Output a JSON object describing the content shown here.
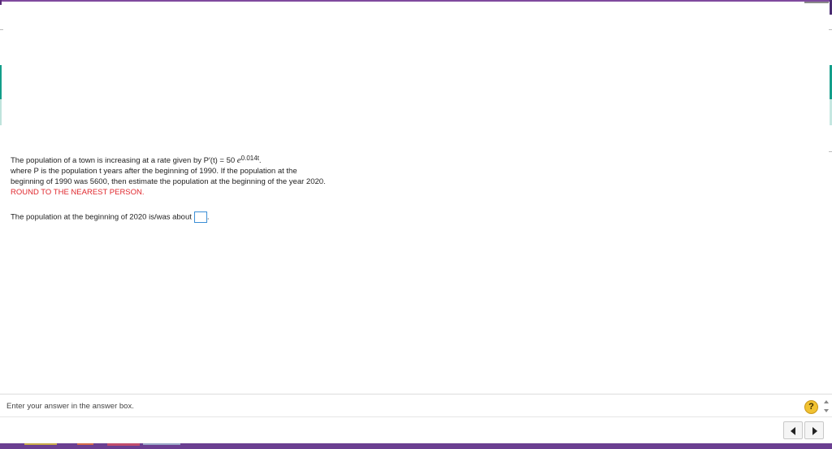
{
  "question": {
    "intro": "The population of a town is increasing at a rate given by ",
    "formula_base": "P′(t) = 50 ",
    "formula_e": "e",
    "formula_exp": "0.014t",
    "formula_tail": ".",
    "line2": "where P is the population t years after the beginning of 1990.  If the population at the",
    "line3": "beginning of 1990 was 5600, then estimate the population at the beginning of the year 2020.",
    "instruction": "ROUND TO THE NEAREST PERSON."
  },
  "answer": {
    "prefix": "The population at the beginning of 2020 is/was about",
    "value": "",
    "suffix": "."
  },
  "status": {
    "message": "Enter your answer in the answer box.",
    "help_label": "?"
  },
  "colors": {
    "accent": "#7f4a9e",
    "teal": "#139e8a",
    "instruction_red": "#e0282e",
    "input_border": "#3b8fd6",
    "help_yellow": "#f1c232"
  },
  "icons": {
    "help": "question-mark-icon",
    "prev": "triangle-left-icon",
    "next": "triangle-right-icon"
  }
}
